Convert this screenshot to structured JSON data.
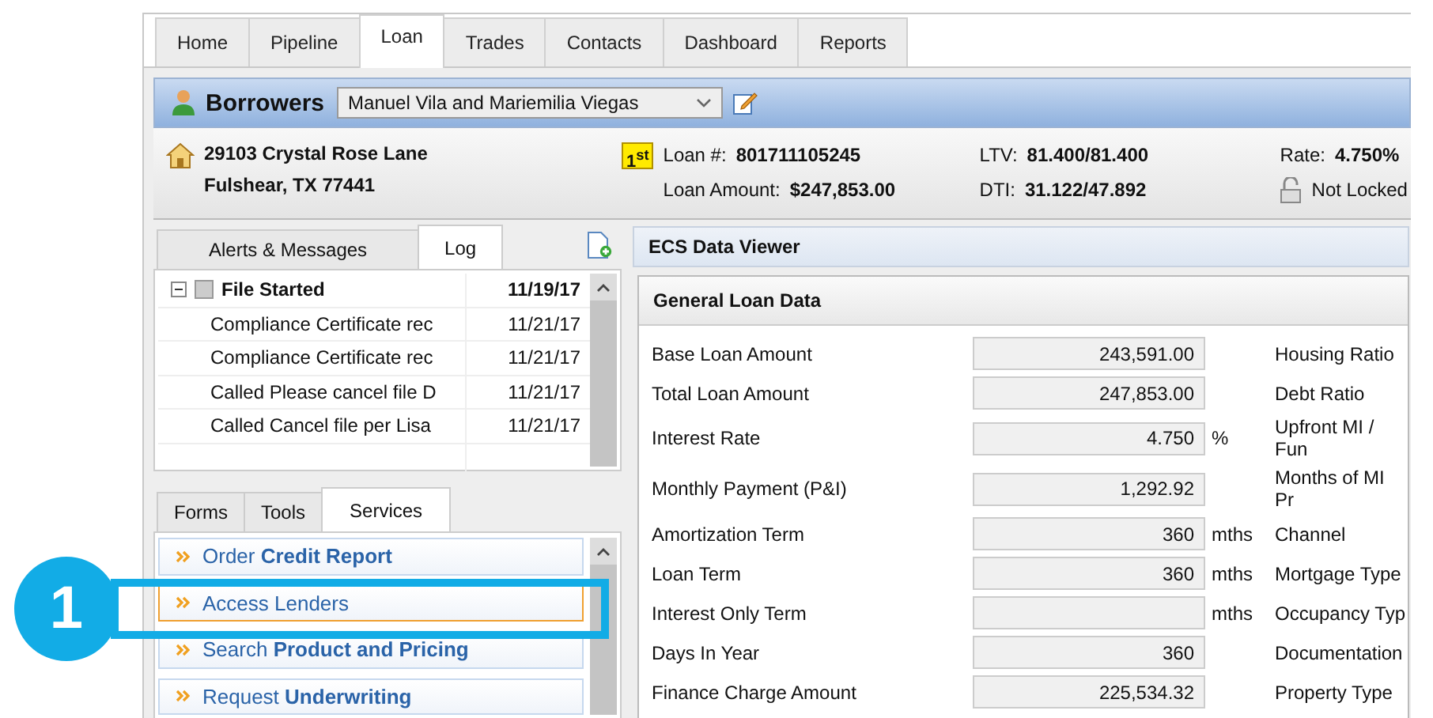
{
  "tabs": [
    {
      "label": "Home",
      "selected": false
    },
    {
      "label": "Pipeline",
      "selected": false
    },
    {
      "label": "Loan",
      "selected": true
    },
    {
      "label": "Trades",
      "selected": false
    },
    {
      "label": "Contacts",
      "selected": false
    },
    {
      "label": "Dashboard",
      "selected": false
    },
    {
      "label": "Reports",
      "selected": false
    }
  ],
  "borrowers": {
    "title": "Borrowers",
    "value": "Manuel Vila and Mariemilia Viegas"
  },
  "loan_summary": {
    "address_line1": "29103 Crystal Rose Lane",
    "address_line2": "Fulshear, TX 77441",
    "lien_badge": "1$^{st}$",
    "columns": [
      [
        {
          "label": "Loan #:",
          "value": "801711105245"
        },
        {
          "label": "Loan Amount:",
          "value": "$247,853.00"
        }
      ],
      [
        {
          "label": "LTV:",
          "value": "81.400/81.400"
        },
        {
          "label": "DTI:",
          "value": "31.122/47.892"
        }
      ],
      [
        {
          "label": "Rate:",
          "value": "4.750%"
        }
      ]
    ],
    "lock_status": {
      "text": "Not Locked",
      "locked": false
    }
  },
  "left_tabs": [
    {
      "label": "Alerts & Messages",
      "selected": false
    },
    {
      "label": "Log",
      "selected": true
    }
  ],
  "log": {
    "items": [
      {
        "label": "File Started",
        "date": "11/19/17",
        "expanded": true,
        "children": [
          {
            "label": "Compliance Certificate rec",
            "date": "11/21/17"
          },
          {
            "label": "Compliance Certificate rec",
            "date": "11/21/17"
          },
          {
            "label": "Called Please cancel file D",
            "date": "11/21/17"
          },
          {
            "label": "Called Cancel file per Lisa",
            "date": "11/21/17"
          }
        ]
      }
    ]
  },
  "bottom_tabs": [
    {
      "label": "Forms",
      "selected": false
    },
    {
      "label": "Tools",
      "selected": false
    },
    {
      "label": "Services",
      "selected": true
    }
  ],
  "services": [
    {
      "text": "Order **Credit Report**",
      "selected": false
    },
    {
      "text": "Access Lenders",
      "selected": true
    },
    {
      "text": "Search **Product and Pricing**",
      "selected": false
    },
    {
      "text": "Request **Underwriting**",
      "selected": false
    }
  ],
  "viewer": {
    "title": "ECS Data Viewer",
    "section_title": "General Loan Data",
    "rows": [
      {
        "label": "Base Loan Amount",
        "value": "243,591.00",
        "right_label": "Housing Ratio"
      },
      {
        "label": "Total Loan Amount",
        "value": "247,853.00",
        "right_label": "Debt Ratio"
      },
      {
        "label": "Interest Rate",
        "value": "4.750",
        "unit": "%",
        "right_label": "Upfront MI / Fun"
      },
      {
        "label": "Monthly Payment (P&I)",
        "value": "1,292.92",
        "right_label": "Months of MI Pr"
      },
      {
        "label": "Amortization Term",
        "value": "360",
        "unit": "mths",
        "right_label": "Channel"
      },
      {
        "label": "Loan Term",
        "value": "360",
        "unit": "mths",
        "right_label": "Mortgage Type"
      },
      {
        "label": "Interest Only Term",
        "unit": "mths",
        "right_label": "Occupancy Typ"
      },
      {
        "label": "Days In Year",
        "value": "360",
        "right_label": "Documentation"
      },
      {
        "label": "Finance Charge Amount",
        "value": "225,534.32",
        "right_label": "Property Type"
      }
    ]
  },
  "callout": {
    "number": "1"
  }
}
